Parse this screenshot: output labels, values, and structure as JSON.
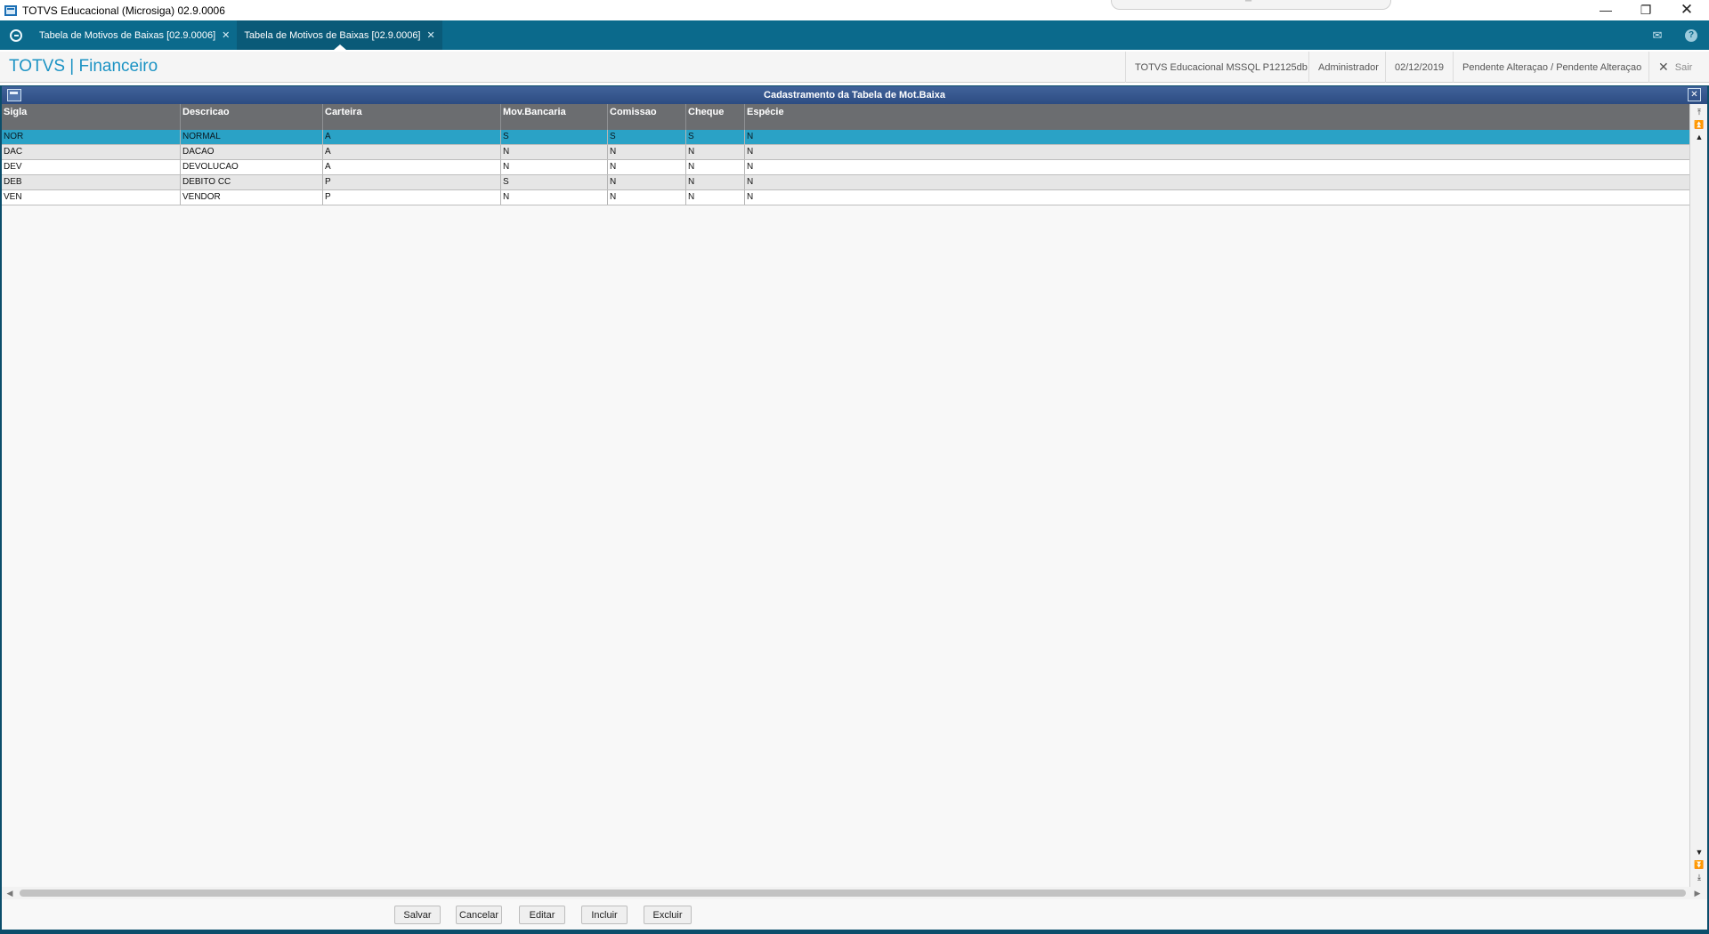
{
  "window": {
    "title": "TOTVS Educacional (Microsiga) 02.9.0006"
  },
  "tabs": [
    {
      "label": "Tabela de Motivos de Baixas [02.9.0006]"
    },
    {
      "label": "Tabela de Motivos de Baixas [02.9.0006]"
    }
  ],
  "header": {
    "brand": "TOTVS | Financeiro",
    "environment": "TOTVS Educacional MSSQL P12125db",
    "user": "Administrador",
    "date": "02/12/2019",
    "status": "Pendente Alteraçao / Pendente Alteraçao",
    "exit_label": "Sair"
  },
  "panel": {
    "title": "Cadastramento da Tabela de Mot.Baixa"
  },
  "grid": {
    "columns": [
      "Sigla",
      "Descricao",
      "Carteira",
      "Mov.Bancaria",
      "Comissao",
      "Cheque",
      "Espécie"
    ],
    "rows": [
      [
        "NOR",
        "NORMAL",
        "A",
        "S",
        "S",
        "S",
        "N"
      ],
      [
        "DAC",
        "DACAO",
        "A",
        "N",
        "N",
        "N",
        "N"
      ],
      [
        "DEV",
        "DEVOLUCAO",
        "A",
        "N",
        "N",
        "N",
        "N"
      ],
      [
        "DEB",
        "DEBITO CC",
        "P",
        "S",
        "N",
        "N",
        "N"
      ],
      [
        "VEN",
        "VENDOR",
        "P",
        "N",
        "N",
        "N",
        "N"
      ]
    ]
  },
  "buttons": {
    "save": "Salvar",
    "cancel": "Cancelar",
    "edit": "Editar",
    "include": "Incluir",
    "delete": "Excluir"
  },
  "colors": {
    "tabbar": "#0b6a8c",
    "brand": "#1c93c4",
    "selected_row": "#2aa2c6",
    "panel_title": "#2d4c82"
  }
}
